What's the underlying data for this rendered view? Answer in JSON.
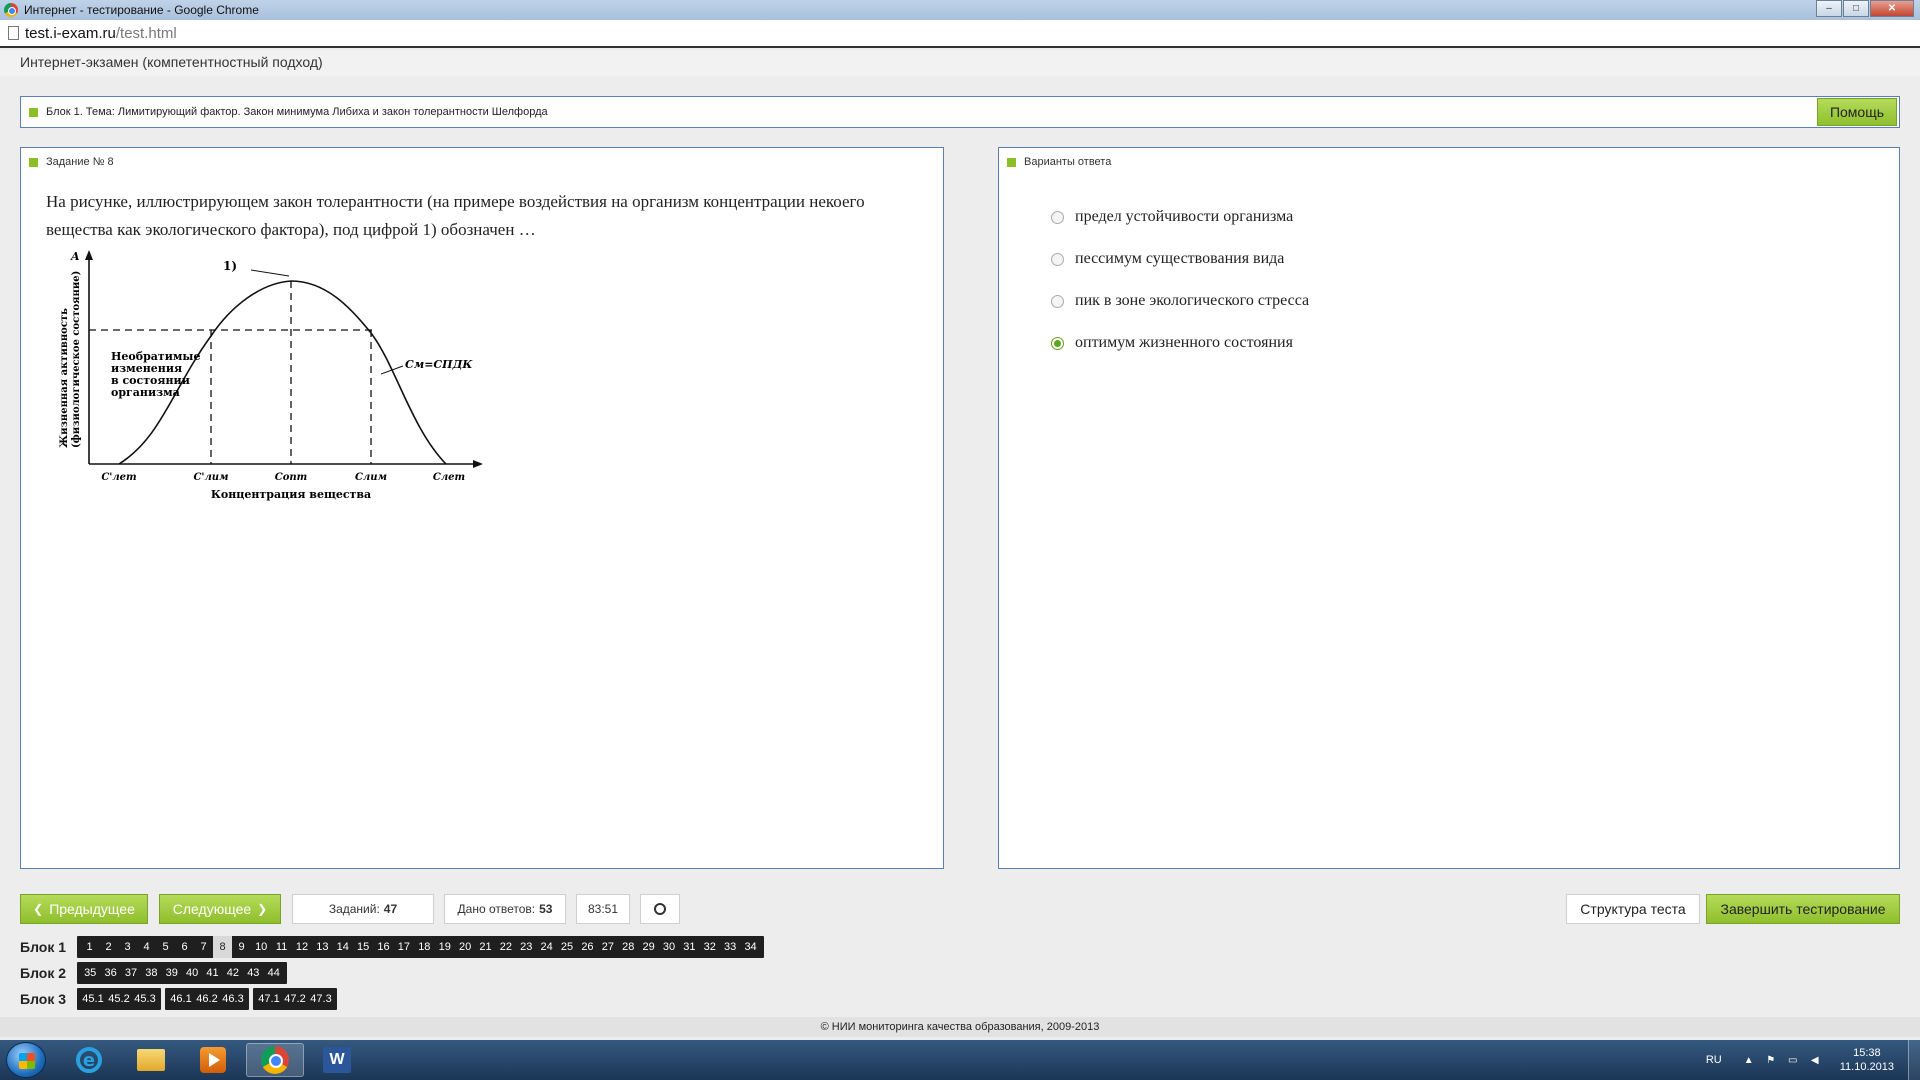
{
  "window": {
    "title": "Интернет - тестирование - Google Chrome",
    "controls": {
      "minimize": "–",
      "maximize": "□",
      "close": "✕"
    }
  },
  "browser": {
    "url_host": "test.i-exam.ru",
    "url_path": "/test.html"
  },
  "app": {
    "header": "Интернет-экзамен (компетентностный подход)"
  },
  "block": {
    "title": "Блок 1. Тема: Лимитирующий фактор. Закон минимума Либиха и закон толерантности Шелфорда",
    "help_label": "Помощь"
  },
  "task": {
    "header": "Задание № 8",
    "question": "На рисунке, иллюстрирующем закон толерантности (на примере воздействия на организм концентрации некоего вещества как экологического фактора), под цифрой 1) обозначен …",
    "figure": {
      "y_axis_letter": "A",
      "y_label_line1": "Жизненная активность",
      "y_label_line2": "(физиологическое состояние)",
      "peak_label": "1)",
      "irreversible_lines": [
        "Необратимые",
        "изменения",
        "в состоянии",
        "организма"
      ],
      "cm_label": "Cм=CПДК",
      "x_ticks": [
        "C'лет",
        "C'лим",
        "Cопт",
        "Cлим",
        "Cлет"
      ],
      "x_label": "Концентрация вещества"
    }
  },
  "answers": {
    "header": "Варианты ответа",
    "options": [
      {
        "label": "предел устойчивости организма",
        "selected": false
      },
      {
        "label": "пессимум существования вида",
        "selected": false
      },
      {
        "label": "пик в зоне экологического стресса",
        "selected": false
      },
      {
        "label": "оптимум жизненного состояния",
        "selected": true
      }
    ]
  },
  "controls": {
    "prev_label": "Предыдущее",
    "next_label": "Следующее",
    "tasks_label": "Заданий:",
    "tasks_count": "47",
    "answered_label": "Дано ответов:",
    "answered_count": "53",
    "timer": "83:51",
    "structure_label": "Структура теста",
    "finish_label": "Завершить тестирование"
  },
  "navigation": {
    "current": "8",
    "rows": [
      {
        "label": "Блок 1",
        "groups": [
          [
            "1",
            "2",
            "3",
            "4",
            "5",
            "6",
            "7",
            "8",
            "9",
            "10",
            "11",
            "12",
            "13",
            "14",
            "15",
            "16",
            "17",
            "18",
            "19",
            "20",
            "21",
            "22",
            "23",
            "24",
            "25",
            "26",
            "27",
            "28",
            "29",
            "30",
            "31",
            "32",
            "33",
            "34"
          ]
        ]
      },
      {
        "label": "Блок 2",
        "groups": [
          [
            "35",
            "36",
            "37",
            "38",
            "39",
            "40",
            "41",
            "42",
            "43",
            "44"
          ]
        ]
      },
      {
        "label": "Блок 3",
        "groups": [
          [
            "45.1",
            "45.2",
            "45.3"
          ],
          [
            "46.1",
            "46.2",
            "46.3"
          ],
          [
            "47.1",
            "47.2",
            "47.3"
          ]
        ]
      }
    ]
  },
  "footer": {
    "text": "© НИИ мониторинга качества образования, 2009-2013"
  },
  "taskbar": {
    "language": "RU",
    "time": "15:38",
    "date": "11.10.2013",
    "icons": [
      "start-orb",
      "internet-explorer-icon",
      "folder-icon",
      "media-player-icon",
      "chrome-icon",
      "word-icon"
    ]
  }
}
